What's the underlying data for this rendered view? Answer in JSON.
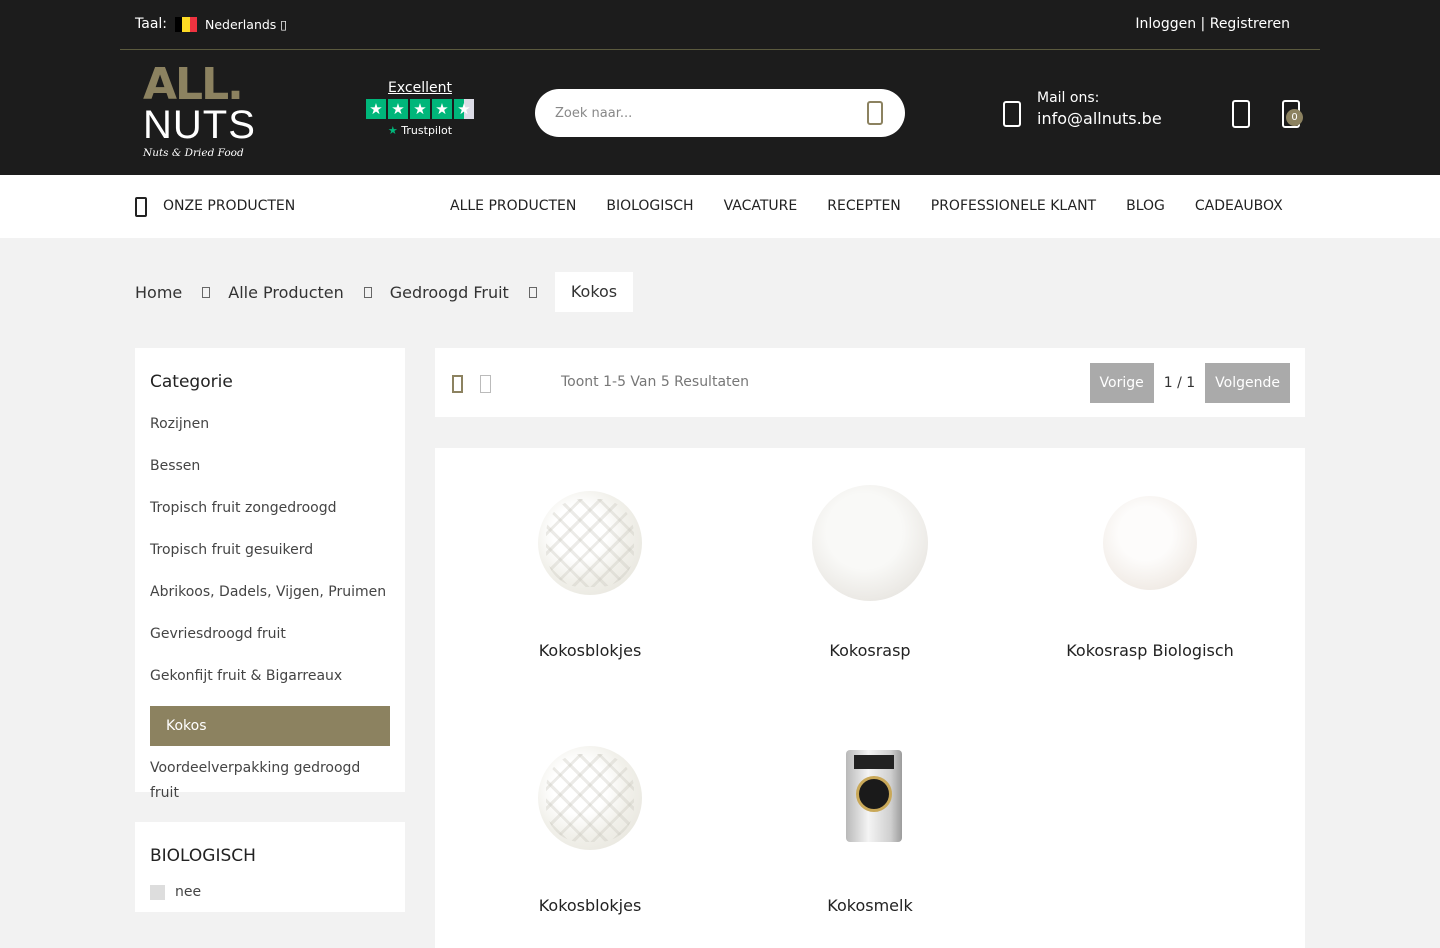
{
  "topbar": {
    "lang_label": "Taal:",
    "lang_value": "Nederlands ▯",
    "flag_colors": [
      "#000000",
      "#fdda24",
      "#ef3340"
    ],
    "auth": "Inloggen | Registreren"
  },
  "logo": {
    "line1": "ALL.",
    "line2": "NUTS",
    "tagline": "Nuts & Dried Food"
  },
  "trustpilot": {
    "rating_text": "Excellent",
    "stars_full": 4,
    "stars_half": 1,
    "brand": "Trustpilot"
  },
  "search": {
    "placeholder": "Zoek naar..."
  },
  "contact": {
    "label": "Mail ons:",
    "email": "info@allnuts.be"
  },
  "cart": {
    "count": "0"
  },
  "nav": {
    "our_products": "ONZE PRODUCTEN",
    "links": [
      "ALLE PRODUCTEN",
      "BIOLOGISCH",
      "VACATURE",
      "RECEPTEN",
      "PROFESSIONELE KLANT",
      "BLOG",
      "CADEAUBOX"
    ]
  },
  "breadcrumb": {
    "items": [
      "Home",
      "Alle Producten",
      "Gedroogd Fruit"
    ],
    "current": "Kokos"
  },
  "sidebar": {
    "title": "Categorie",
    "items": [
      "Rozijnen",
      "Bessen",
      "Tropisch fruit zongedroogd",
      "Tropisch fruit gesuikerd",
      "Abrikoos, Dadels, Vijgen, Pruimen",
      "Gevriesdroogd fruit",
      "Gekonfijt fruit & Bigarreaux",
      "Kokos",
      "Voordeelverpakking gedroogd fruit"
    ],
    "active": "Kokos"
  },
  "filter": {
    "title": "BIOLOGISCH",
    "option": "nee"
  },
  "toolbar": {
    "results": "Toont 1-5 Van 5 Resultaten",
    "prev": "Vorige",
    "page": "1 / 1",
    "next": "Volgende"
  },
  "products": [
    "Kokosblokjes",
    "Kokosrasp",
    "Kokosrasp Biologisch",
    "Kokosblokjes",
    "Kokosmelk"
  ],
  "colors": {
    "brand": "#8c8260",
    "dark": "#1c1c1c",
    "trustpilot": "#00b67a"
  }
}
